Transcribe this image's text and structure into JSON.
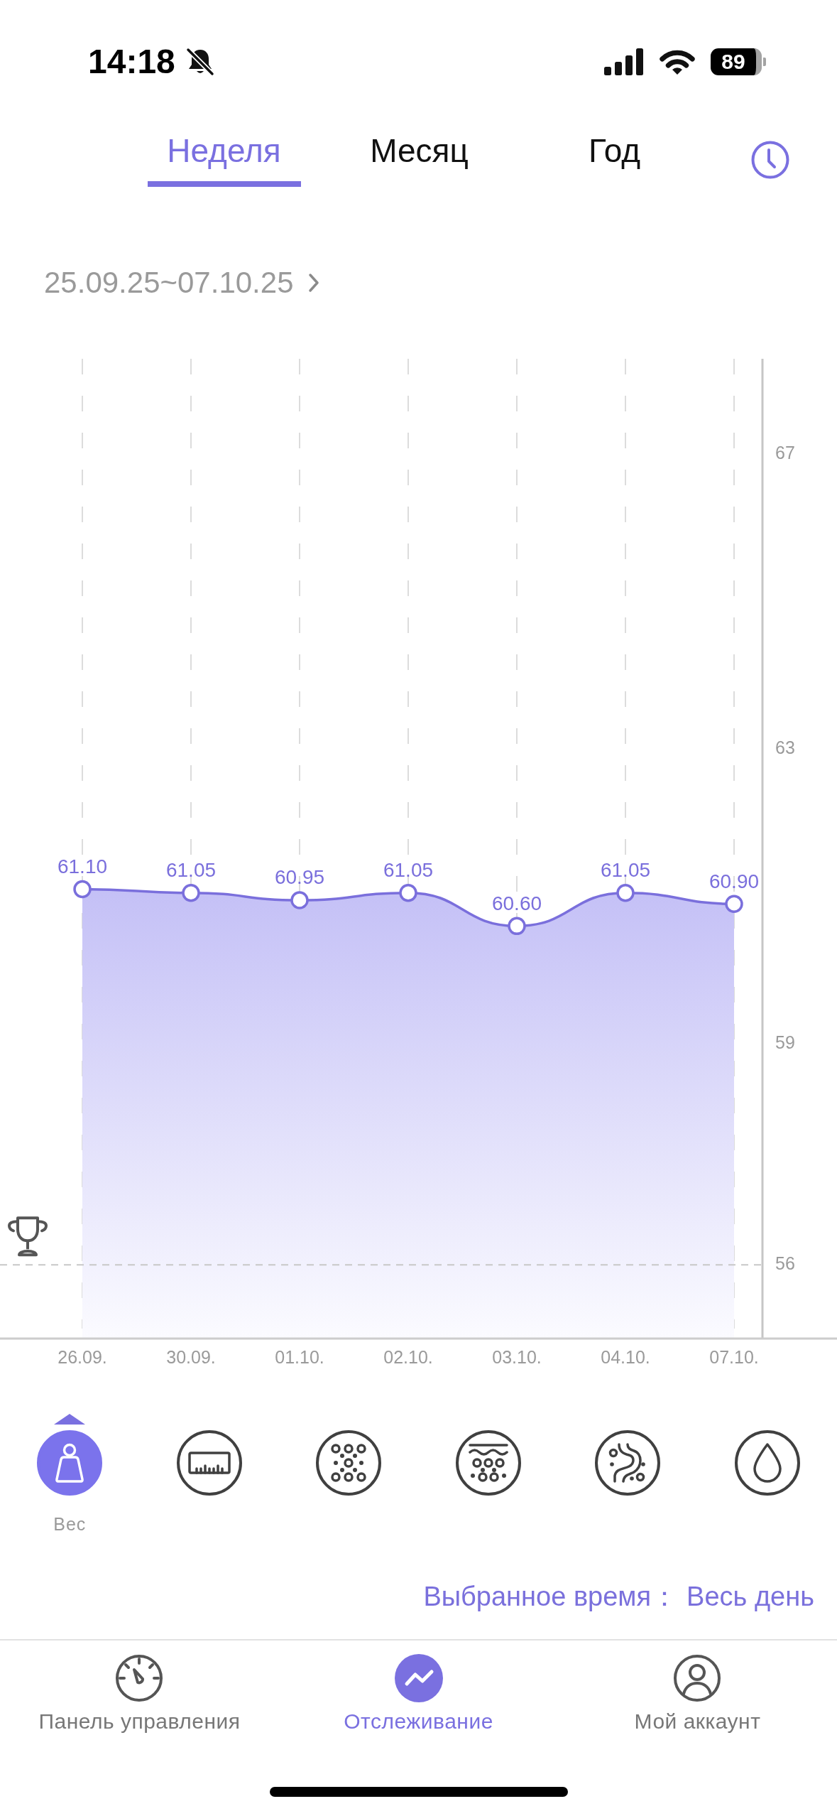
{
  "status_bar": {
    "time": "14:18",
    "battery": "89"
  },
  "tabs": [
    {
      "label": "Неделя",
      "selected": true
    },
    {
      "label": "Месяц",
      "selected": false
    },
    {
      "label": "Год",
      "selected": false
    }
  ],
  "date_range": "25.09.25~07.10.25",
  "chart": {
    "chart_data": {
      "type": "area",
      "categories": [
        "26.09.",
        "30.09.",
        "01.10.",
        "02.10.",
        "03.10.",
        "04.10.",
        "07.10."
      ],
      "values": [
        61.1,
        61.05,
        60.95,
        61.05,
        60.6,
        61.05,
        60.9
      ],
      "value_labels": [
        "61.10",
        "61.05",
        "60.95",
        "61.05",
        "60.60",
        "61.05",
        "60.90"
      ],
      "ylim": [
        55,
        68.3
      ],
      "yticks": [
        56,
        59,
        63,
        67
      ],
      "grid": true,
      "ref_lines": [
        {
          "axis": "y",
          "value": 56
        }
      ]
    }
  },
  "metrics": [
    {
      "kind": "weight",
      "label": "Вес",
      "selected": true
    },
    {
      "kind": "ruler",
      "selected": false
    },
    {
      "kind": "dots",
      "selected": false
    },
    {
      "kind": "layers",
      "selected": false
    },
    {
      "kind": "organ",
      "selected": false
    },
    {
      "kind": "drop",
      "selected": false
    }
  ],
  "selected_time": {
    "label": "Выбранное время：",
    "value": "Весь день"
  },
  "bottom_nav": [
    {
      "label": "Панель управления",
      "selected": false
    },
    {
      "label": "Отслеживание",
      "selected": true
    },
    {
      "label": "Мой аккаунт",
      "selected": false
    }
  ]
}
